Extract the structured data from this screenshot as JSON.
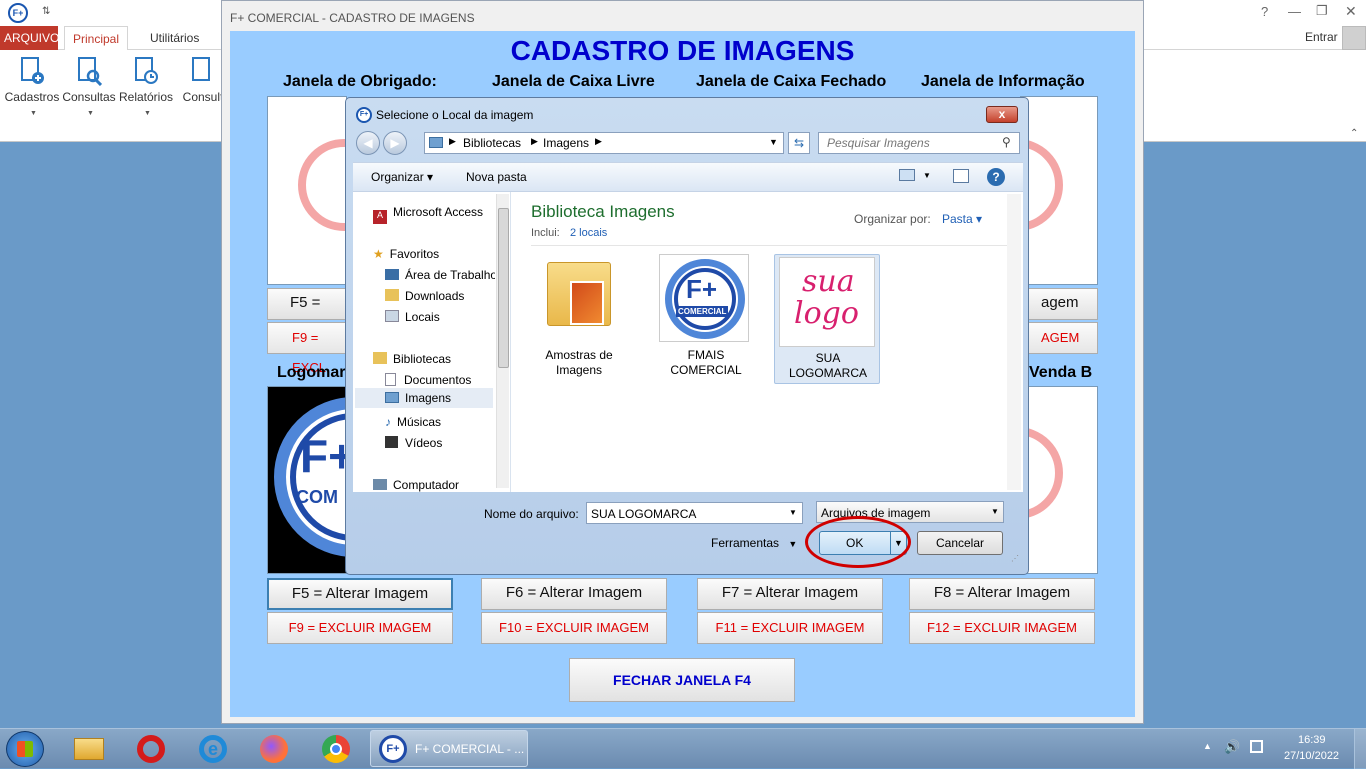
{
  "app": {
    "quick_access_arrow": "⇅",
    "help": "?",
    "user": "Entrar",
    "tabs": [
      "ARQUIVO",
      "Principal",
      "Utilitários"
    ],
    "ribbon": [
      "Cadastros",
      "Consultas",
      "Relatórios",
      "Consult"
    ]
  },
  "window": {
    "title": "F+ COMERCIAL - CADASTRO DE IMAGENS",
    "heading": "CADASTRO DE IMAGENS",
    "sections": [
      "Janela de Obrigado:",
      "Janela de Caixa Livre",
      "Janela de Caixa Fechado",
      "Janela de Informação"
    ],
    "row2_left": "Logomar",
    "row2_right": "Venda B",
    "top_alter_left": "F5 = Alter",
    "top_alter_right": "agem",
    "top_excl_left": "F9 = EXCL",
    "top_excl_right": "AGEM",
    "alter_buttons": [
      "F5 = Alterar Imagem",
      "F6 = Alterar Imagem",
      "F7 = Alterar Imagem",
      "F8 = Alterar Imagem"
    ],
    "delete_buttons": [
      "F9 = EXCLUIR IMAGEM",
      "F10 = EXCLUIR IMAGEM",
      "F11 = EXCLUIR IMAGEM",
      "F12 = EXCLUIR IMAGEM"
    ],
    "close_button": "FECHAR JANELA F4",
    "logo_text": "F+",
    "logo_sub": "COM"
  },
  "dialog": {
    "title": "Selecione o Local da imagem",
    "breadcrumb": [
      "Bibliotecas",
      "Imagens"
    ],
    "search_placeholder": "Pesquisar Imagens",
    "toolbar": {
      "organize": "Organizar",
      "new_folder": "Nova pasta"
    },
    "nav_items": [
      "Microsoft Access",
      "Favoritos",
      "Área de Trabalho",
      "Downloads",
      "Locais",
      "Bibliotecas",
      "Documentos",
      "Imagens",
      "Músicas",
      "Vídeos",
      "Computador"
    ],
    "library_title": "Biblioteca Imagens",
    "includes_label": "Inclui:",
    "includes_value": "2 locais",
    "arrange_label": "Organizar por:",
    "arrange_value": "Pasta",
    "files": [
      {
        "name": "Amostras de Imagens"
      },
      {
        "name": "FMAIS COMERCIAL"
      },
      {
        "name": "SUA LOGOMARCA"
      }
    ],
    "logo_inner": "F+",
    "logo_band": "COMERCIAL",
    "sua_logo": [
      "sua",
      "logo"
    ],
    "filename_label": "Nome do arquivo:",
    "filename_value": "SUA LOGOMARCA",
    "filetype": "Arquivos de imagem",
    "tools": "Ferramentas",
    "ok": "OK",
    "cancel": "Cancelar",
    "close": "x"
  },
  "taskbar": {
    "active_app": "F+ COMERCIAL - ...",
    "time": "16:39",
    "date": "27/10/2022"
  },
  "colors": {
    "accent": "#0000cc",
    "danger": "#e00000",
    "panel": "#99ccff",
    "highlight": "#d00000"
  }
}
